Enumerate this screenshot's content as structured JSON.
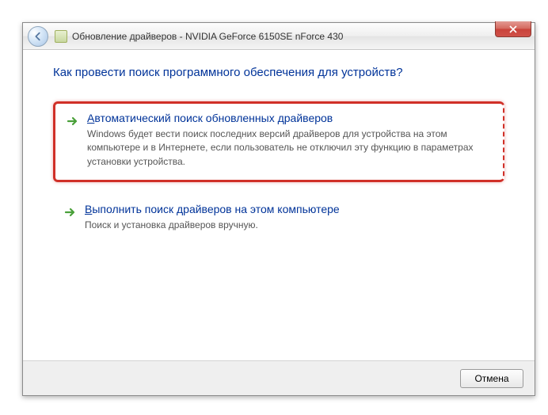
{
  "titlebar": {
    "title": "Обновление драйверов - NVIDIA GeForce 6150SE nForce 430"
  },
  "heading": "Как провести поиск программного обеспечения для устройств?",
  "options": [
    {
      "title_first": "А",
      "title_rest": "втоматический поиск обновленных драйверов",
      "desc": "Windows будет вести поиск последних версий драйверов для устройства на этом компьютере и в Интернете, если пользователь не отключил эту функцию в параметрах установки устройства."
    },
    {
      "title_first": "В",
      "title_rest": "ыполнить поиск драйверов на этом компьютере",
      "desc": "Поиск и установка драйверов вручную."
    }
  ],
  "footer": {
    "cancel": "Отмена"
  }
}
